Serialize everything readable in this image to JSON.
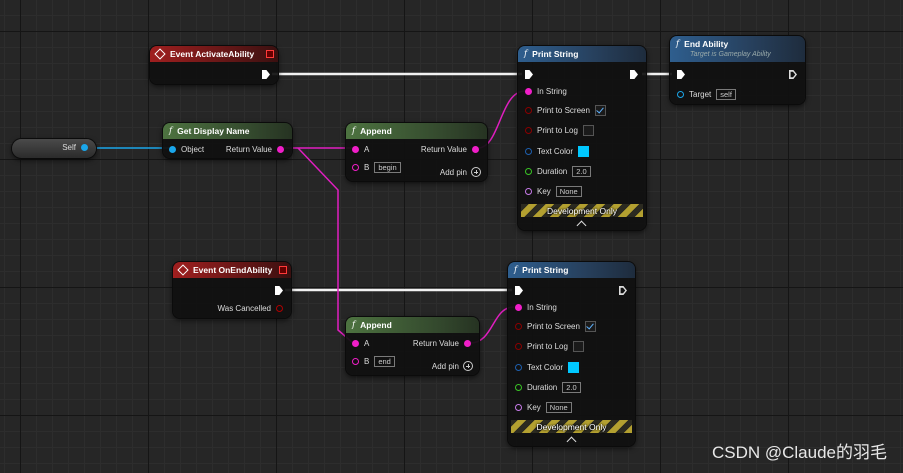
{
  "self_node": {
    "label": "Self"
  },
  "event_activate": {
    "title": "Event ActivateAbility"
  },
  "event_end": {
    "title": "Event OnEndAbility",
    "was_cancelled": "Was Cancelled"
  },
  "get_display_name": {
    "title": "Get Display Name",
    "object": "Object",
    "return_value": "Return Value"
  },
  "append1": {
    "title": "Append",
    "a": "A",
    "b": "B",
    "b_value": "begin",
    "return_value": "Return Value",
    "add_pin": "Add pin"
  },
  "append2": {
    "title": "Append",
    "a": "A",
    "b": "B",
    "b_value": "end",
    "return_value": "Return Value",
    "add_pin": "Add pin"
  },
  "print1": {
    "title": "Print String",
    "in_string": "In String",
    "print_to_screen": "Print to Screen",
    "print_to_log": "Print to Log",
    "text_color": "Text Color",
    "duration": "Duration",
    "duration_value": "2.0",
    "key": "Key",
    "key_value": "None",
    "dev_only": "Development Only"
  },
  "print2": {
    "title": "Print String",
    "in_string": "In String",
    "print_to_screen": "Print to Screen",
    "print_to_log": "Print to Log",
    "text_color": "Text Color",
    "duration": "Duration",
    "duration_value": "2.0",
    "key": "Key",
    "key_value": "None",
    "dev_only": "Development Only"
  },
  "end_ability": {
    "title": "End Ability",
    "subtitle": "Target is Gameplay Ability",
    "target": "Target",
    "target_value": "self"
  },
  "watermark": "CSDN @Claude的羽毛",
  "colors": {
    "string_pin": "#f01ec8",
    "object_pin": "#1aa6ea",
    "bool_pin": "#8a0000",
    "struct_pin": "#1e5fae",
    "float_pin": "#39c425",
    "name_pin": "#c67ae8",
    "text_color_swatch": "#00c8ff"
  }
}
